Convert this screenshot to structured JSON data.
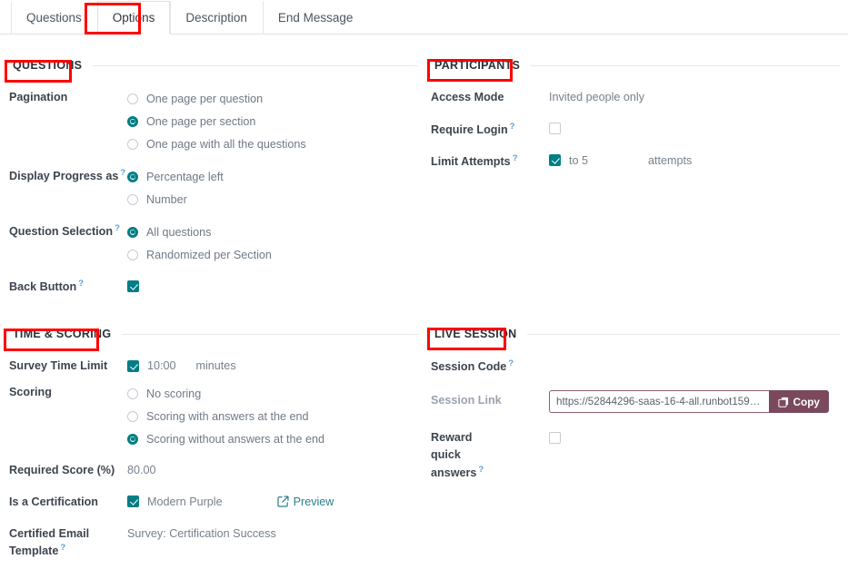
{
  "tabs": [
    {
      "label": "Questions",
      "active": false
    },
    {
      "label": "Options",
      "active": true
    },
    {
      "label": "Description",
      "active": false
    },
    {
      "label": "End Message",
      "active": false
    }
  ],
  "sections": {
    "questions": {
      "title": "QUESTIONS",
      "pagination": {
        "label": "Pagination",
        "options": [
          {
            "label": "One page per question",
            "selected": false
          },
          {
            "label": "One page per section",
            "selected": true
          },
          {
            "label": "One page with all the questions",
            "selected": false
          }
        ]
      },
      "display_progress": {
        "label": "Display Progress as",
        "help": "?",
        "options": [
          {
            "label": "Percentage left",
            "selected": true
          },
          {
            "label": "Number",
            "selected": false
          }
        ]
      },
      "question_selection": {
        "label": "Question Selection",
        "help": "?",
        "options": [
          {
            "label": "All questions",
            "selected": true
          },
          {
            "label": "Randomized per Section",
            "selected": false
          }
        ]
      },
      "back_button": {
        "label": "Back Button",
        "help": "?",
        "checked": true
      }
    },
    "participants": {
      "title": "PARTICIPANTS",
      "access_mode": {
        "label": "Access Mode",
        "value": "Invited people only"
      },
      "require_login": {
        "label": "Require Login",
        "help": "?",
        "checked": false
      },
      "limit_attempts": {
        "label": "Limit Attempts",
        "help": "?",
        "checked": true,
        "value_text": "to 5",
        "suffix": "attempts"
      }
    },
    "time_scoring": {
      "title": "TIME & SCORING",
      "survey_time_limit": {
        "label": "Survey Time Limit",
        "checked": true,
        "value": "10:00",
        "suffix": "minutes"
      },
      "scoring": {
        "label": "Scoring",
        "options": [
          {
            "label": "No scoring",
            "selected": false
          },
          {
            "label": "Scoring with answers at the end",
            "selected": false
          },
          {
            "label": "Scoring without answers at the end",
            "selected": true
          }
        ]
      },
      "required_score": {
        "label": "Required Score (%)",
        "value": "80.00"
      },
      "is_certification": {
        "label": "Is a Certification",
        "checked": true,
        "value": "Modern Purple",
        "preview_label": "Preview",
        "preview_icon": "external-link-icon"
      },
      "certified_email_template": {
        "label": "Certified Email Template",
        "help": "?",
        "value": "Survey: Certification Success"
      }
    },
    "live_session": {
      "title": "LIVE SESSION",
      "session_code": {
        "label": "Session Code",
        "help": "?",
        "value": ""
      },
      "session_link": {
        "label": "Session Link",
        "value": "https://52844296-saas-16-4-all.runbot159.odoo.c...",
        "copy_label": "Copy",
        "copy_icon": "copy-icon"
      },
      "reward_quick_answers": {
        "label": "Reward quick answers",
        "help": "?",
        "checked": false
      }
    }
  },
  "colors": {
    "accent_teal": "#017e84",
    "annotation_red": "#ff0000",
    "copy_button": "#7a4a5c",
    "help_blue": "#5a9ed6",
    "label": "#3c444e",
    "value": "#76808c"
  },
  "annotations": [
    {
      "name": "options-tab-highlight",
      "target": "Options"
    },
    {
      "name": "questions-header-highlight",
      "target": "QUESTIONS"
    },
    {
      "name": "participants-header-highlight",
      "target": "PARTICIPANTS"
    },
    {
      "name": "time-scoring-header-highlight",
      "target": "TIME & SCORING"
    },
    {
      "name": "live-session-header-highlight",
      "target": "LIVE SESSION"
    }
  ]
}
